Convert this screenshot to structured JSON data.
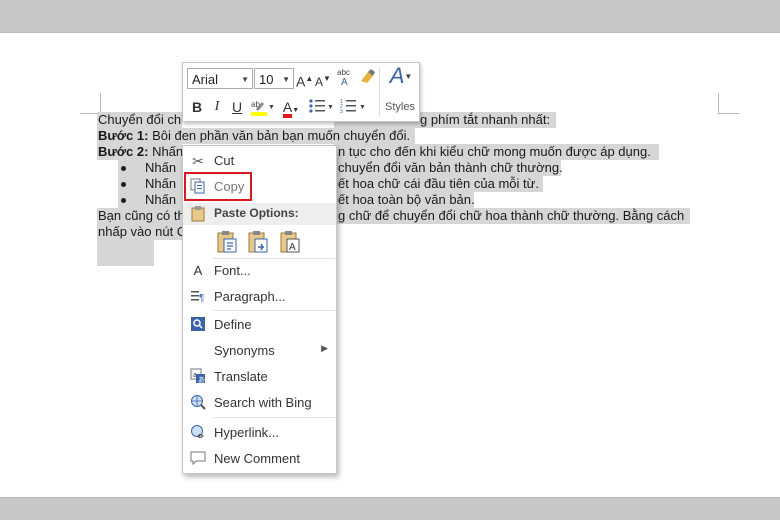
{
  "document": {
    "line1": "Chuyển đổi ch",
    "line1_right": "g phím tắt nhanh nhất:",
    "step1_bold": "Bước 1:",
    "step1_text": " Bôi đen phần văn bản bạn muốn chuyển đổi.",
    "step2_bold": "Bước 2:",
    "step2_text": " Nhấn",
    "step2_right": "n tục cho đến khi kiểu chữ mong muốn được áp dụng.",
    "bullet1_left": "Nhấn",
    "bullet1_right": "chuyển đổi văn bản thành chữ thường.",
    "bullet2_left": "Nhấn",
    "bullet2_right": "ết hoa chữ cái đầu tiên của mỗi từ.",
    "bullet3_left": "Nhấn",
    "bullet3_right": "ết hoa toàn bộ văn bản.",
    "para_left": "Bạn cũng có th",
    "para_right": "g chữ để chuyển đổi chữ hoa thành chữ thường. Bằng cách",
    "para2_left": "nhấp vào nút C"
  },
  "mini_toolbar": {
    "font_name": "Arial",
    "font_size": "10",
    "bold": "B",
    "italic": "I",
    "underline": "U",
    "styles_label": "Styles",
    "grow_font": "A",
    "shrink_font": "A",
    "font_color": "A",
    "styles_icon": "A"
  },
  "context_menu": {
    "cut": "Cut",
    "copy": "Copy",
    "paste_options": "Paste Options:",
    "font": "Font...",
    "paragraph": "Paragraph...",
    "define": "Define",
    "synonyms": "Synonyms",
    "translate": "Translate",
    "search_bing": "Search with Bing",
    "hyperlink": "Hyperlink...",
    "new_comment": "New Comment"
  },
  "colors": {
    "highlight_box": "#d9191f",
    "selection": "#d6d6d6",
    "icon_blue": "#3a63a8"
  }
}
